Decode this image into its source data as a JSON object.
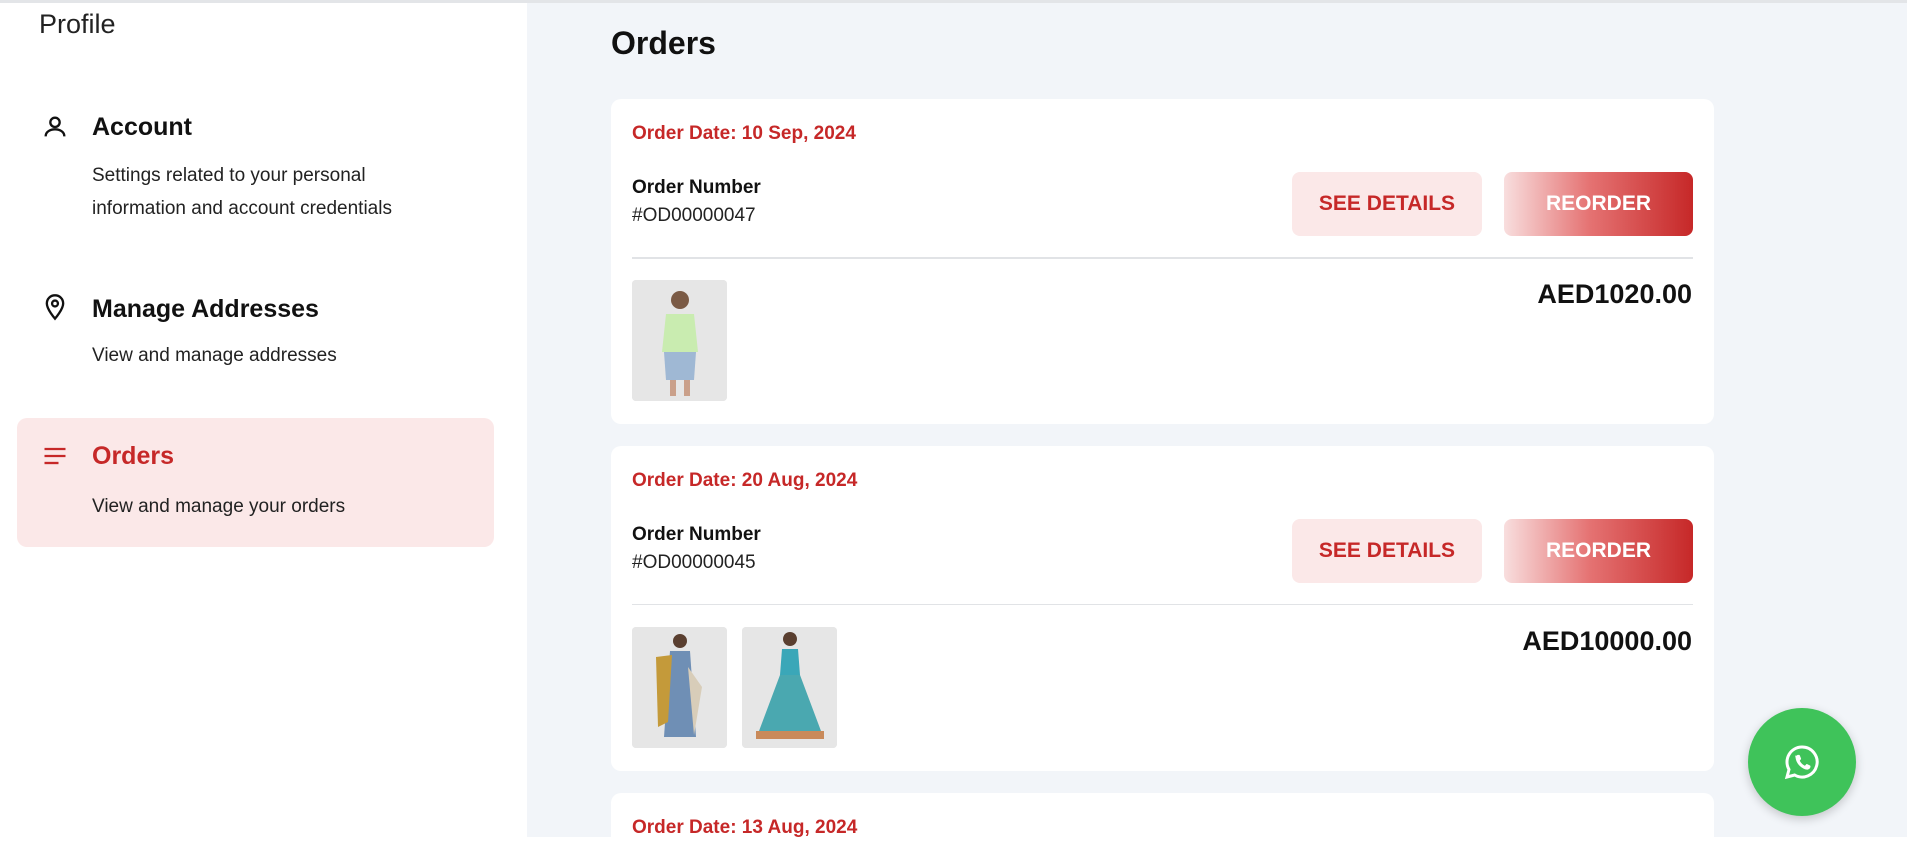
{
  "sidebar": {
    "title": "Profile",
    "items": [
      {
        "label": "Account",
        "description": "Settings related to your personal information and account credentials",
        "icon": "person-icon",
        "active": false
      },
      {
        "label": "Manage Addresses",
        "description": "View and manage addresses",
        "icon": "location-pin-icon",
        "active": false
      },
      {
        "label": "Orders",
        "description": "View and manage your orders",
        "icon": "list-icon",
        "active": true
      }
    ]
  },
  "main": {
    "title": "Orders",
    "orders": [
      {
        "date": "Order Date: 10 Sep, 2024",
        "number_label": "Order Number",
        "number": "#OD00000047",
        "details_label": "SEE DETAILS",
        "reorder_label": "REORDER",
        "total": "AED1020.00"
      },
      {
        "date": "Order Date: 20 Aug, 2024",
        "number_label": "Order Number",
        "number": "#OD00000045",
        "details_label": "SEE DETAILS",
        "reorder_label": "REORDER",
        "total": "AED10000.00"
      },
      {
        "date": "Order Date: 13 Aug, 2024"
      }
    ]
  },
  "colors": {
    "accent": "#c62828",
    "accent_light": "#fbe8e8",
    "main_bg": "#f2f5f9",
    "whatsapp": "#3fc35a"
  },
  "floating": {
    "icon": "whatsapp-icon"
  }
}
